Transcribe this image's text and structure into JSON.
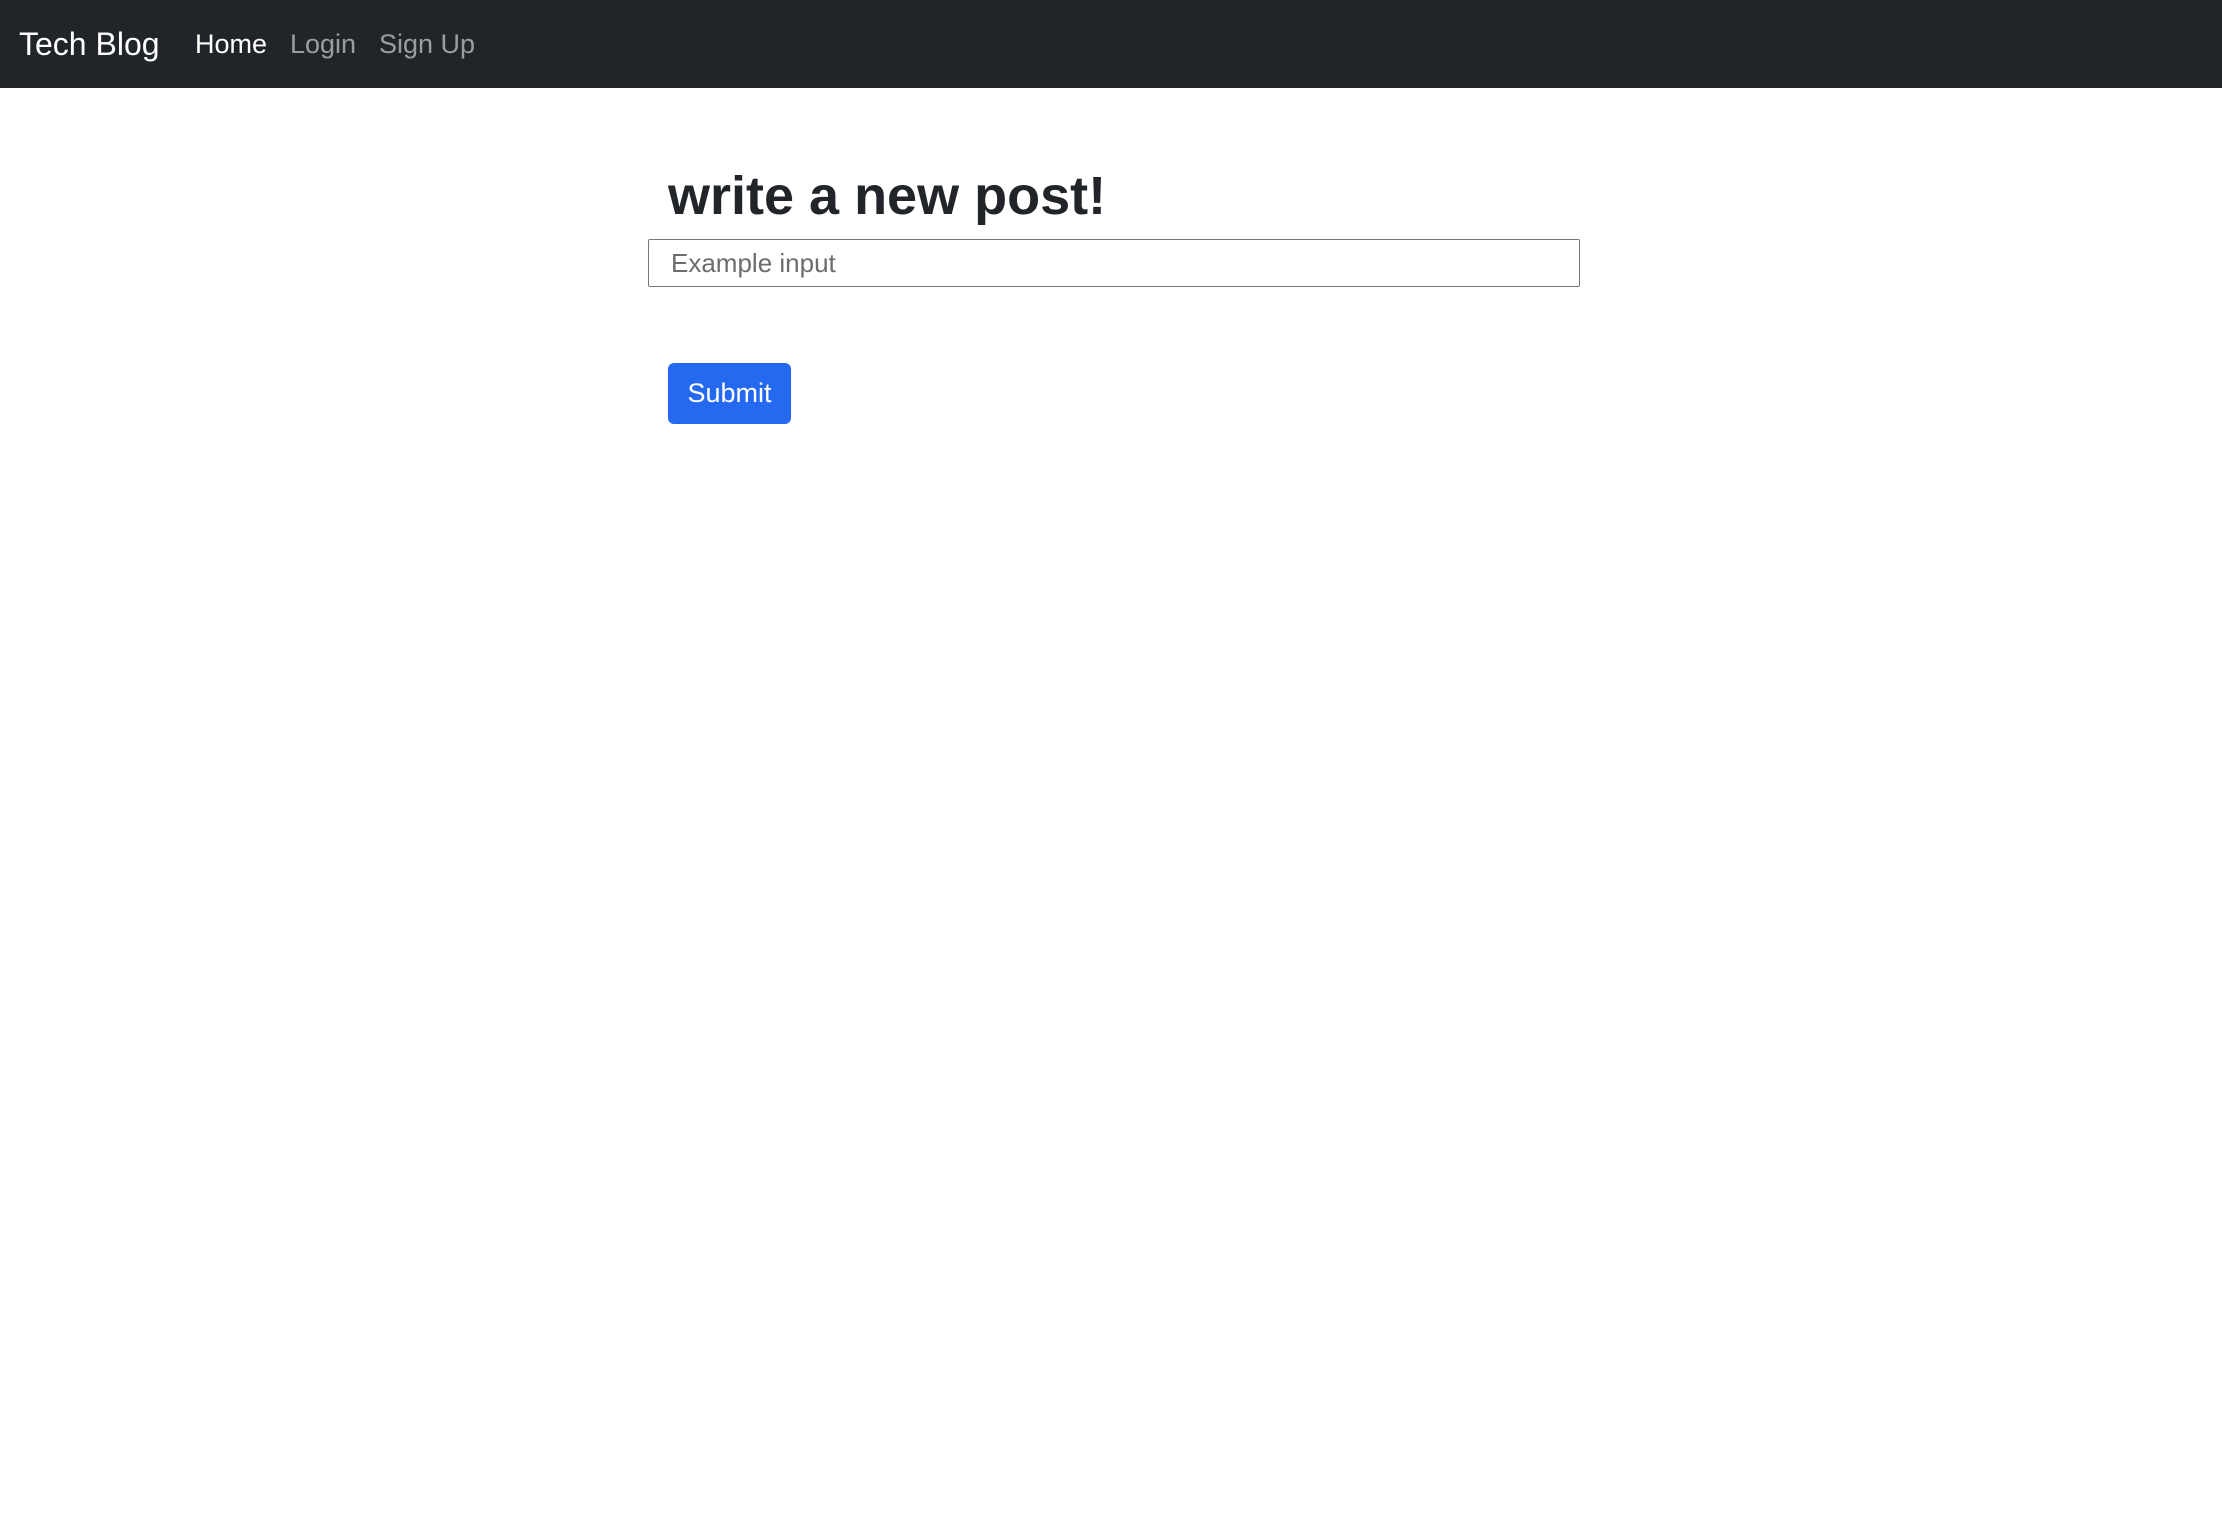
{
  "navbar": {
    "brand": "Tech Blog",
    "links": [
      {
        "label": "Home",
        "active": true
      },
      {
        "label": "Login",
        "active": false
      },
      {
        "label": "Sign Up",
        "active": false
      }
    ],
    "background_color": "#212529"
  },
  "main": {
    "title": "write a new post!",
    "input": {
      "value": "",
      "placeholder": "Example input"
    },
    "submit_label": "Submit",
    "accent_color": "#2469f0"
  }
}
